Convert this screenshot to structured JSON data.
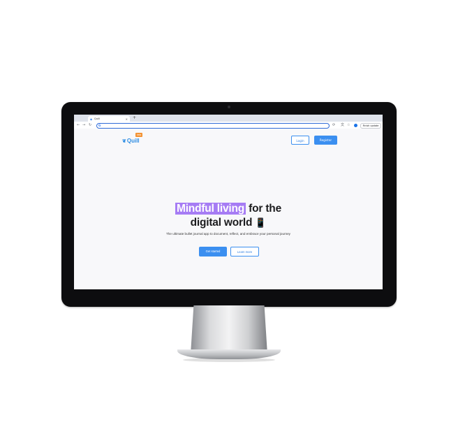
{
  "browser": {
    "tab_title": "Quill",
    "tab_close": "×",
    "new_tab": "+",
    "omnibox_icon": "G",
    "update_button": "Finish update",
    "profile_color": "#1a73e8"
  },
  "site": {
    "logo_text": "Quill",
    "beta_badge": "beta",
    "login_label": "Login",
    "register_label": "Register",
    "headline_highlight": "Mindful living",
    "headline_rest": "for the",
    "headline_line2": "digital world",
    "headline_emoji": "📱",
    "subtitle": "The ultimate bullet journal app to document, reflect, and embrace your personal journey",
    "primary_cta": "Get started",
    "secondary_cta": "Learn more",
    "accent_color": "#3b8ff0",
    "highlight_color": "#a67cf4",
    "beta_color": "#f39232"
  },
  "icons": {
    "back": "←",
    "forward": "→",
    "reload": "↻",
    "extensions": "⟳",
    "translate": "文",
    "bookmark": "☆"
  }
}
